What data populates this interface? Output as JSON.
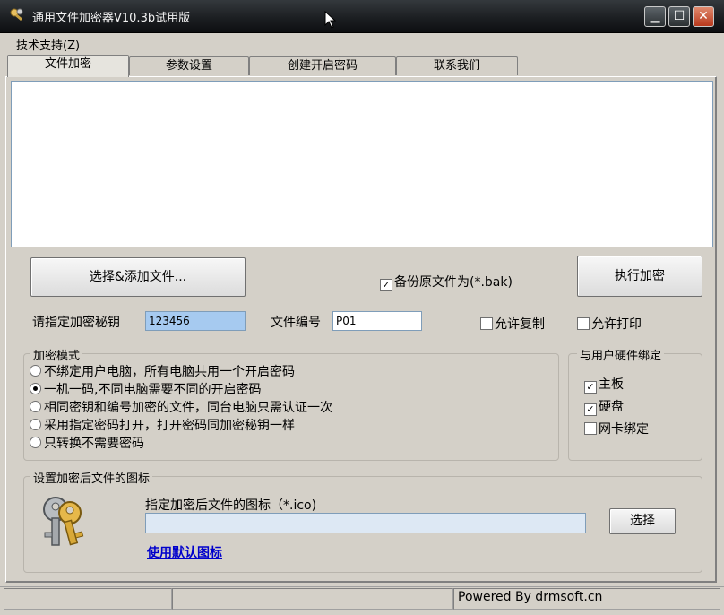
{
  "window": {
    "title": "通用文件加密器V10.3b试用版"
  },
  "menu": {
    "items": [
      "技术支持(Z)"
    ]
  },
  "tabs": [
    "文件加密",
    "参数设置",
    "创建开启密码",
    "联系我们"
  ],
  "buttons": {
    "select_add": "选择&添加文件...",
    "execute": "执行加密",
    "choose_icon": "选择"
  },
  "options": {
    "backup_label": "备份原文件为(*.bak)",
    "backup_checked": true,
    "allow_copy_label": "允许复制",
    "allow_copy_checked": false,
    "allow_print_label": "允许打印",
    "allow_print_checked": false
  },
  "fields": {
    "key_label": "请指定加密秘钥",
    "key_value": "123456",
    "file_no_label": "文件编号",
    "file_no_value": "P01"
  },
  "mode_group": {
    "title": "加密模式",
    "options": [
      "不绑定用户电脑，所有电脑共用一个开启密码",
      "一机一码,不同电脑需要不同的开启密码",
      "相同密钥和编号加密的文件，同台电脑只需认证一次",
      "采用指定密码打开，打开密码同加密秘钥一样",
      "只转换不需要密码"
    ],
    "selected_index": 1
  },
  "hardware_group": {
    "title": "与用户硬件绑定",
    "items": [
      {
        "label": "主板",
        "checked": true
      },
      {
        "label": "硬盘",
        "checked": true
      },
      {
        "label": "网卡绑定",
        "checked": false
      }
    ]
  },
  "icon_group": {
    "title": "设置加密后文件的图标",
    "field_label": "指定加密后文件的图标（*.ico)",
    "field_value": "",
    "default_link": "使用默认图标"
  },
  "status": {
    "powered_by": "Powered By drmsoft.cn"
  },
  "colors": {
    "titlebar": "#1c1f22",
    "highlight_input": "#a6caf0",
    "link": "#0000cc"
  }
}
